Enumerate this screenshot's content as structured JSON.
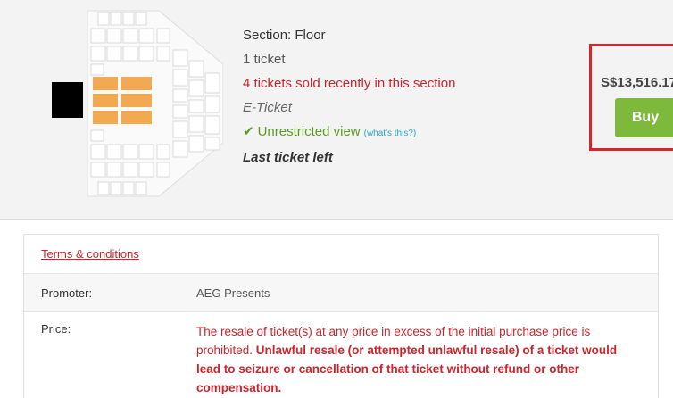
{
  "listing": {
    "section": "Section: Floor",
    "quantity": "1 ticket",
    "sold_notice": "4 tickets sold recently in this section",
    "ticket_type": "E-Ticket",
    "view_label": "Unrestricted view",
    "view_help_link": "(what's this?)",
    "last_ticket": "Last ticket left"
  },
  "purchase": {
    "price": "S$13,516.17",
    "buy_label": "Buy"
  },
  "info": {
    "terms_link": "Terms & conditions",
    "promoter_label": "Promoter:",
    "promoter_value": "AEG Presents",
    "price_label": "Price:",
    "price_text_normal": "The resale of ticket(s) at any price in excess of the initial purchase price is prohibited. ",
    "price_text_bold": "Unlawful resale (or attempted unlawful resale) of a ticket would lead to seizure or cancellation of that ticket without refund or other compensation."
  },
  "colors": {
    "accent_red": "#c9252c",
    "buy_green": "#7db93b",
    "view_green": "#5a9b27",
    "highlight_orange": "#f2a951"
  }
}
